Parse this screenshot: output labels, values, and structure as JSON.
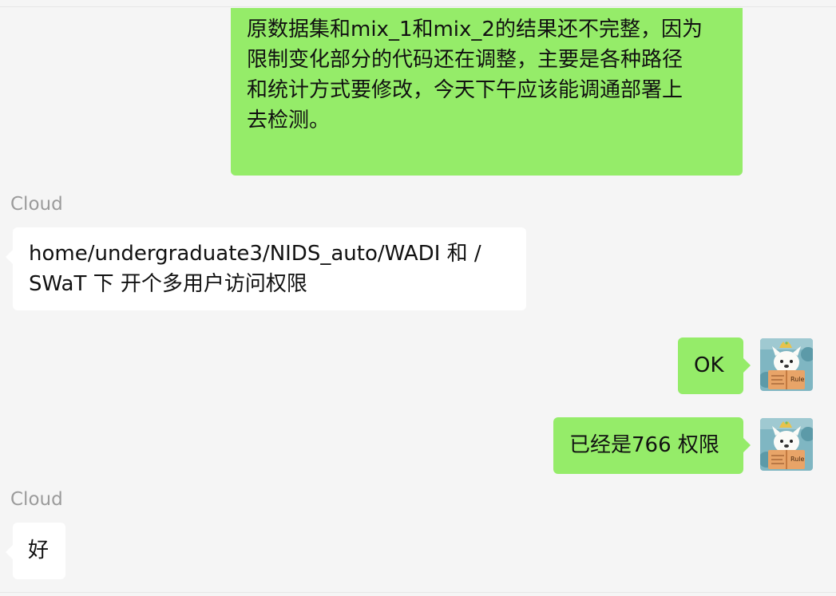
{
  "chat": {
    "messages": [
      {
        "id": "m1",
        "side": "right",
        "lines": [
          "原数据集和mix_1和mix_2的结果还不完整，因为",
          "限制变化部分的代码还在调整，主要是各种路径",
          "和统计方式要修改，今天下午应该能调通部署上",
          "去检测。"
        ]
      },
      {
        "id": "m2",
        "side": "left",
        "sender": "Cloud",
        "lines": [
          "home/undergraduate3/NIDS_auto/WADI 和 /",
          "SWaT 下  开个多用户访问权限"
        ]
      },
      {
        "id": "m3",
        "side": "right",
        "text": "OK"
      },
      {
        "id": "m4",
        "side": "right",
        "text": "已经是766 权限"
      },
      {
        "id": "m5",
        "side": "left",
        "sender": "Cloud",
        "text": "好"
      }
    ],
    "avatar": {
      "book_title": "Rule",
      "icon": "puppy-reading-book-avatar"
    },
    "colors": {
      "background": "#f5f5f5",
      "outgoing_bubble": "#95ec69",
      "incoming_bubble": "#ffffff",
      "sender_name": "#9b9b9b"
    }
  }
}
